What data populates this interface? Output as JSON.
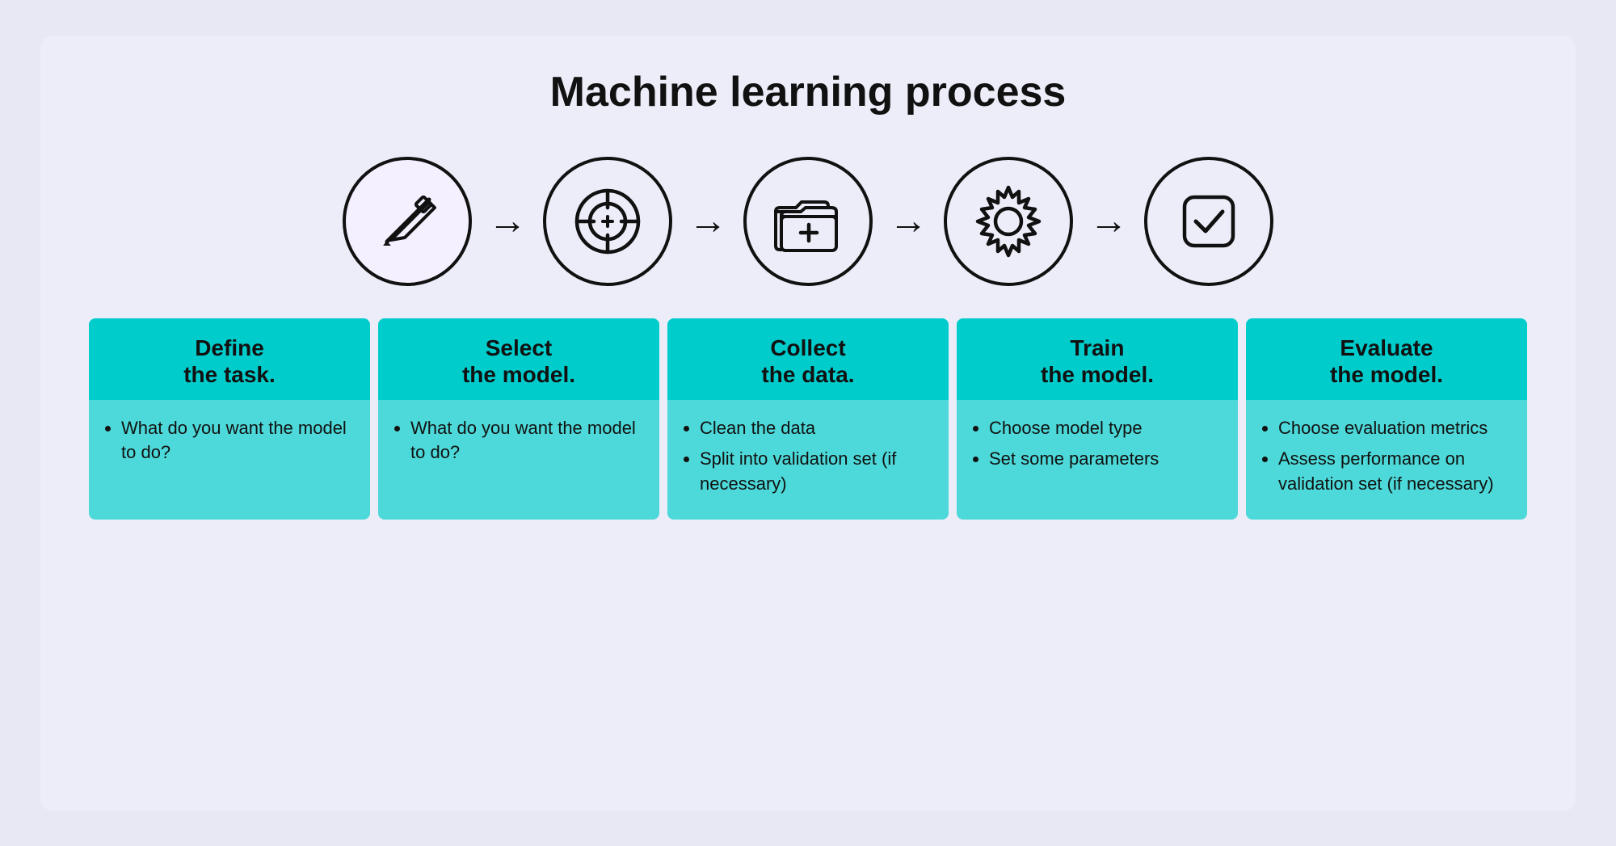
{
  "title": "Machine learning process",
  "steps": [
    {
      "id": "define",
      "icon": "pencil",
      "header_line1": "Define",
      "header_line2": "the task.",
      "bullets": [
        "What do you want the model to do?"
      ]
    },
    {
      "id": "select",
      "icon": "target",
      "header_line1": "Select",
      "header_line2": "the model.",
      "bullets": [
        "What do you want the model to do?"
      ]
    },
    {
      "id": "collect",
      "icon": "folder",
      "header_line1": "Collect",
      "header_line2": "the data.",
      "bullets": [
        "Clean the data",
        "Split into validation set (if necessary)"
      ]
    },
    {
      "id": "train",
      "icon": "gear",
      "header_line1": "Train",
      "header_line2": "the model.",
      "bullets": [
        "Choose model type",
        "Set some parameters"
      ]
    },
    {
      "id": "evaluate",
      "icon": "checkmark",
      "header_line1": "Evaluate",
      "header_line2": "the model.",
      "bullets": [
        "Choose evaluation metrics",
        "Assess performance on validation set (if necessary)"
      ]
    }
  ],
  "arrow_symbol": "→"
}
